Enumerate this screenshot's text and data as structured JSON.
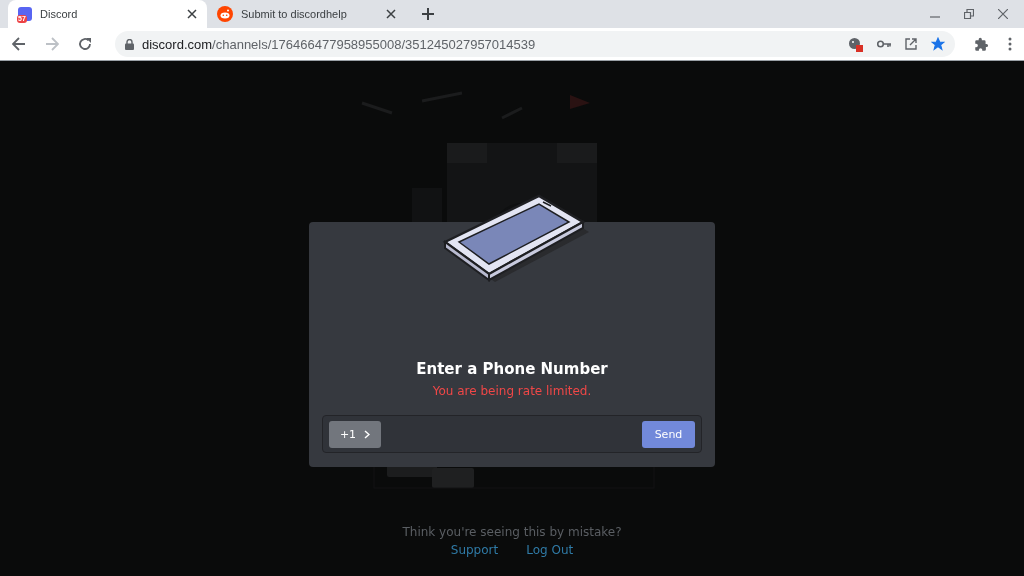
{
  "browser": {
    "tabs": [
      {
        "kind": "discord",
        "title": "Discord",
        "badge": "57",
        "selected": true
      },
      {
        "kind": "reddit",
        "title": "Submit to discordhelp",
        "selected": false
      }
    ],
    "address": {
      "domain": "discord.com",
      "path": "/channels/176466477958955008/351245027957014539"
    },
    "bookmarked": true
  },
  "background": {
    "prompt": "Think you're seeing this by mistake?",
    "links": [
      "Support",
      "Log Out"
    ]
  },
  "modal": {
    "title": "Enter a Phone Number",
    "error": "You are being rate limited.",
    "country_code": "+1",
    "send_button": "Send"
  }
}
